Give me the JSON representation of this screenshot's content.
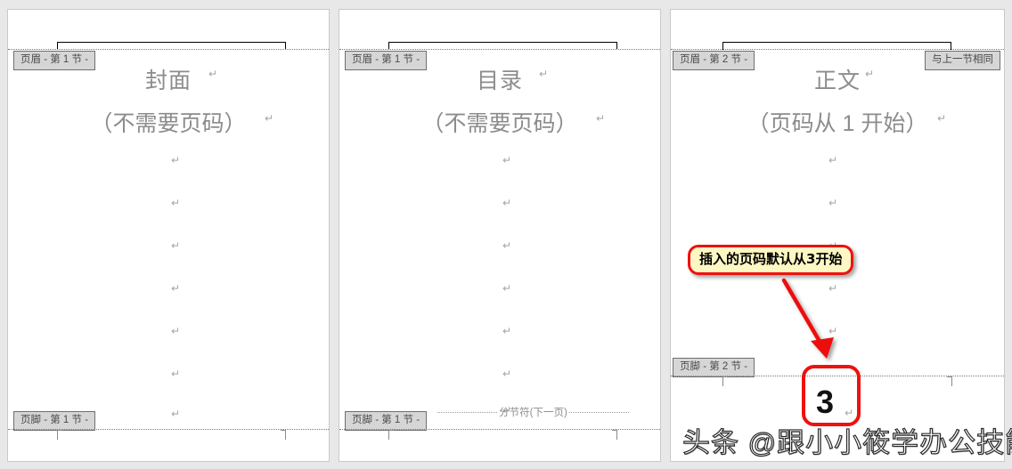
{
  "app": {
    "view": "Word print layout — header & footer editing",
    "background_color": "#e8e8e8",
    "page_color": "#ffffff",
    "accent_red": "#ee1111",
    "callout_fill": "#fdf7c3",
    "tag_fill": "#d6d6d6"
  },
  "pages": [
    {
      "id": "page-1",
      "header_tag": "页眉 - 第 1 节 -",
      "footer_tag": "页脚 - 第 1 节 -",
      "same_as_previous_tag": null,
      "title": "封面",
      "subtitle": "（不需要页码）",
      "paragraph_mark": "↵",
      "paragraph_mark_count": 8,
      "section_break": null,
      "page_number": null
    },
    {
      "id": "page-2",
      "header_tag": "页眉 - 第 1 节 -",
      "footer_tag": "页脚 - 第 1 节 -",
      "same_as_previous_tag": null,
      "title": "目录",
      "subtitle": "（不需要页码）",
      "paragraph_mark": "↵",
      "paragraph_mark_count": 8,
      "section_break": "分节符(下一页)",
      "page_number": null
    },
    {
      "id": "page-3",
      "header_tag": "页眉 - 第 2 节 -",
      "footer_tag": "页脚 - 第 2 节 -",
      "same_as_previous_tag": "与上一节相同",
      "title": "正文",
      "subtitle": "（页码从 1 开始）",
      "paragraph_mark": "↵",
      "paragraph_mark_count": 6,
      "section_break": null,
      "page_number": "3"
    }
  ],
  "annotations": {
    "callout_text": "插入的页码默认从3开始",
    "arrow": "red-down-right-arrow",
    "highlight": "red-rounded-rectangle-around-page-number"
  },
  "watermark": {
    "text": "头条 @跟小小筱学办公技能"
  }
}
